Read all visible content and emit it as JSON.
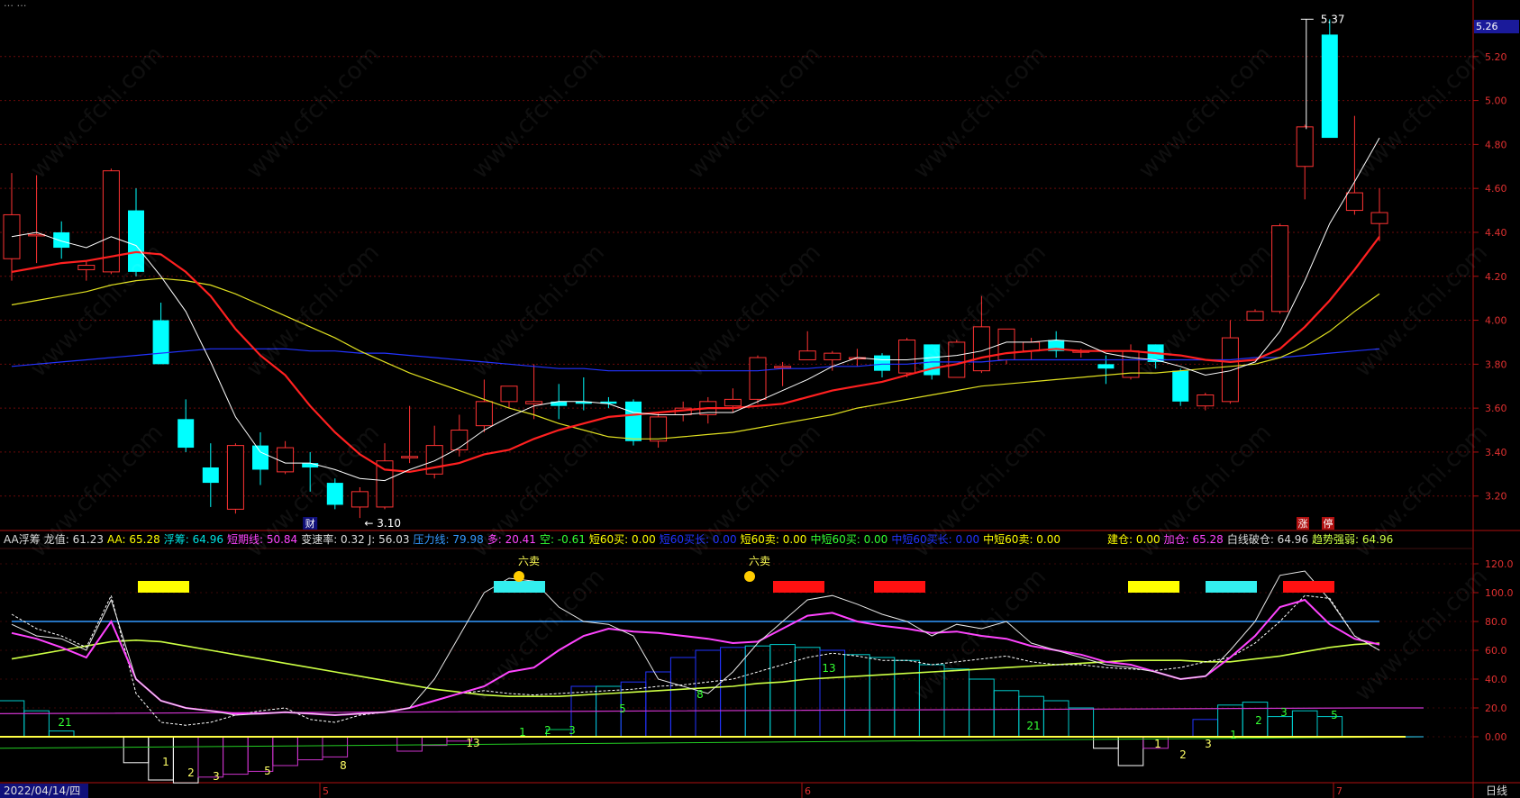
{
  "header": {
    "title_fragment": "… …"
  },
  "price_axis": {
    "ticks": [
      "5.26",
      "5.20",
      "5.00",
      "4.80",
      "4.60",
      "4.40",
      "4.20",
      "4.00",
      "3.80",
      "3.60",
      "3.40",
      "3.20"
    ],
    "current": "5.26"
  },
  "osc_axis": {
    "ticks": [
      "120.0",
      "100.0",
      "80.0",
      "60.0",
      "40.0",
      "20.0",
      "0.00"
    ]
  },
  "annotations": {
    "high": "5.37",
    "low": "← 3.10",
    "fin_marker": "财",
    "zhang": "涨",
    "ting": "停",
    "sell1": "六卖",
    "sell2": "六卖"
  },
  "indicator_bar": [
    {
      "text": "AA浮筹",
      "color": "#dddddd"
    },
    {
      "text": "龙值: 61.23",
      "color": "#dddddd"
    },
    {
      "text": "AA: 65.28",
      "color": "#ffff00"
    },
    {
      "text": "浮筹: 64.96",
      "color": "#00e0e0"
    },
    {
      "text": "短期线: 50.84",
      "color": "#ff44ff"
    },
    {
      "text": "变速率: 0.32",
      "color": "#dddddd"
    },
    {
      "text": "J: 56.03",
      "color": "#dddddd"
    },
    {
      "text": "压力线: 79.98",
      "color": "#3399ff"
    },
    {
      "text": "多: 20.41",
      "color": "#ff44ff"
    },
    {
      "text": "空: -0.61",
      "color": "#33ff33"
    },
    {
      "text": "短60买: 0.00",
      "color": "#ffff00"
    },
    {
      "text": "短60买长: 0.00",
      "color": "#2233ff"
    },
    {
      "text": "短60卖: 0.00",
      "color": "#ffff00"
    },
    {
      "text": "中短60买: 0.00",
      "color": "#33ff33"
    },
    {
      "text": "中短60买长: 0.00",
      "color": "#2233ff"
    },
    {
      "text": "中短60卖: 0.00",
      "color": "#ffff00"
    },
    {
      "text": "建仓: 0.00",
      "color": "#ffff00"
    },
    {
      "text": "加仓: 65.28",
      "color": "#ff44ff"
    },
    {
      "text": "白线破仓: 64.96",
      "color": "#dddddd"
    },
    {
      "text": "趋势强弱: 64.96",
      "color": "#ccff44"
    }
  ],
  "time_axis": {
    "date": "2022/04/14/四",
    "months": [
      "5",
      "6",
      "7"
    ],
    "period": "日线"
  },
  "watermark": "www.cfchi.com",
  "colors": {
    "up": "#ff3333",
    "down": "#00ffff",
    "ma5": "#ffffff",
    "ma10": "#ff2020",
    "ma20": "#e0e020",
    "ma60": "#2233ff"
  },
  "chart_data": [
    {
      "type": "candlestick",
      "ylim": [
        3.08,
        5.4
      ],
      "candles": [
        [
          4.28,
          4.48,
          4.67,
          4.18
        ],
        [
          4.39,
          4.39,
          4.66,
          4.26
        ],
        [
          4.4,
          4.33,
          4.45,
          4.28
        ],
        [
          4.23,
          4.25,
          4.27,
          4.18
        ],
        [
          4.22,
          4.68,
          4.69,
          4.21
        ],
        [
          4.5,
          4.22,
          4.6,
          4.2
        ],
        [
          4.0,
          3.8,
          4.08,
          3.8
        ],
        [
          3.55,
          3.42,
          3.64,
          3.4
        ],
        [
          3.33,
          3.26,
          3.44,
          3.15
        ],
        [
          3.14,
          3.43,
          3.44,
          3.12
        ],
        [
          3.43,
          3.32,
          3.49,
          3.25
        ],
        [
          3.31,
          3.42,
          3.45,
          3.3
        ],
        [
          3.35,
          3.33,
          3.4,
          3.22
        ],
        [
          3.26,
          3.16,
          3.28,
          3.14
        ],
        [
          3.15,
          3.22,
          3.24,
          3.1
        ],
        [
          3.15,
          3.36,
          3.44,
          3.14
        ],
        [
          3.38,
          3.38,
          3.61,
          3.35
        ],
        [
          3.3,
          3.43,
          3.52,
          3.28
        ],
        [
          3.41,
          3.5,
          3.57,
          3.38
        ],
        [
          3.52,
          3.63,
          3.73,
          3.49
        ],
        [
          3.63,
          3.7,
          3.7,
          3.6
        ],
        [
          3.62,
          3.63,
          3.8,
          3.55
        ],
        [
          3.63,
          3.61,
          3.71,
          3.55
        ],
        [
          3.63,
          3.62,
          3.74,
          3.59
        ],
        [
          3.63,
          3.62,
          3.65,
          3.6
        ],
        [
          3.63,
          3.45,
          3.64,
          3.43
        ],
        [
          3.45,
          3.56,
          3.58,
          3.42
        ],
        [
          3.57,
          3.6,
          3.63,
          3.54
        ],
        [
          3.57,
          3.63,
          3.65,
          3.53
        ],
        [
          3.61,
          3.64,
          3.69,
          3.58
        ],
        [
          3.64,
          3.83,
          3.84,
          3.62
        ],
        [
          3.79,
          3.79,
          3.81,
          3.7
        ],
        [
          3.82,
          3.86,
          3.95,
          3.82
        ],
        [
          3.82,
          3.85,
          3.86,
          3.77
        ],
        [
          3.83,
          3.83,
          3.87,
          3.79
        ],
        [
          3.84,
          3.77,
          3.85,
          3.74
        ],
        [
          3.76,
          3.91,
          3.92,
          3.74
        ],
        [
          3.89,
          3.75,
          3.89,
          3.73
        ],
        [
          3.74,
          3.9,
          3.91,
          3.74
        ],
        [
          3.77,
          3.97,
          4.11,
          3.76
        ],
        [
          3.82,
          3.96,
          3.96,
          3.8
        ],
        [
          3.86,
          3.9,
          3.92,
          3.82
        ],
        [
          3.91,
          3.86,
          3.95,
          3.83
        ],
        [
          3.86,
          3.86,
          3.87,
          3.83
        ],
        [
          3.8,
          3.78,
          3.84,
          3.71
        ],
        [
          3.74,
          3.86,
          3.89,
          3.73
        ],
        [
          3.89,
          3.81,
          3.89,
          3.78
        ],
        [
          3.77,
          3.63,
          3.78,
          3.61
        ],
        [
          3.61,
          3.66,
          3.67,
          3.59
        ],
        [
          3.63,
          3.92,
          4.0,
          3.62
        ],
        [
          4.0,
          4.04,
          4.05,
          4.0
        ],
        [
          4.04,
          4.43,
          4.44,
          4.03
        ],
        [
          4.7,
          4.88,
          4.89,
          4.55
        ],
        [
          5.3,
          4.83,
          5.37,
          4.83
        ],
        [
          4.5,
          4.58,
          4.93,
          4.48
        ],
        [
          4.44,
          4.49,
          4.6,
          4.36
        ]
      ],
      "ma5": [
        4.38,
        4.4,
        4.36,
        4.33,
        4.38,
        4.34,
        4.2,
        4.04,
        3.81,
        3.56,
        3.4,
        3.35,
        3.35,
        3.32,
        3.28,
        3.27,
        3.32,
        3.36,
        3.42,
        3.5,
        3.56,
        3.61,
        3.63,
        3.63,
        3.62,
        3.58,
        3.57,
        3.57,
        3.58,
        3.58,
        3.63,
        3.68,
        3.73,
        3.79,
        3.83,
        3.82,
        3.82,
        3.83,
        3.84,
        3.86,
        3.9,
        3.9,
        3.91,
        3.9,
        3.85,
        3.83,
        3.82,
        3.79,
        3.75,
        3.77,
        3.81,
        3.95,
        4.18,
        4.44,
        4.63,
        4.83
      ],
      "ma10": [
        4.22,
        4.24,
        4.26,
        4.27,
        4.29,
        4.31,
        4.3,
        4.22,
        4.11,
        3.96,
        3.84,
        3.75,
        3.61,
        3.49,
        3.39,
        3.32,
        3.31,
        3.33,
        3.35,
        3.39,
        3.41,
        3.46,
        3.5,
        3.53,
        3.56,
        3.57,
        3.58,
        3.59,
        3.6,
        3.6,
        3.61,
        3.62,
        3.65,
        3.68,
        3.7,
        3.72,
        3.75,
        3.78,
        3.8,
        3.83,
        3.85,
        3.86,
        3.87,
        3.86,
        3.86,
        3.86,
        3.85,
        3.84,
        3.82,
        3.81,
        3.82,
        3.87,
        3.97,
        4.09,
        4.23,
        4.38
      ],
      "ma20": [
        4.07,
        4.09,
        4.11,
        4.13,
        4.16,
        4.18,
        4.19,
        4.18,
        4.16,
        4.12,
        4.07,
        4.02,
        3.97,
        3.92,
        3.86,
        3.81,
        3.76,
        3.72,
        3.68,
        3.64,
        3.6,
        3.57,
        3.53,
        3.5,
        3.47,
        3.46,
        3.46,
        3.47,
        3.48,
        3.49,
        3.51,
        3.53,
        3.55,
        3.57,
        3.6,
        3.62,
        3.64,
        3.66,
        3.68,
        3.7,
        3.71,
        3.72,
        3.73,
        3.74,
        3.75,
        3.76,
        3.76,
        3.77,
        3.78,
        3.79,
        3.8,
        3.83,
        3.88,
        3.95,
        4.04,
        4.12
      ],
      "ma60": [
        3.79,
        3.8,
        3.81,
        3.82,
        3.83,
        3.84,
        3.85,
        3.86,
        3.87,
        3.87,
        3.87,
        3.87,
        3.86,
        3.86,
        3.85,
        3.85,
        3.84,
        3.83,
        3.82,
        3.81,
        3.8,
        3.79,
        3.78,
        3.78,
        3.77,
        3.77,
        3.77,
        3.77,
        3.77,
        3.77,
        3.77,
        3.78,
        3.78,
        3.79,
        3.79,
        3.8,
        3.8,
        3.81,
        3.81,
        3.81,
        3.82,
        3.82,
        3.82,
        3.82,
        3.82,
        3.82,
        3.82,
        3.82,
        3.82,
        3.82,
        3.83,
        3.83,
        3.84,
        3.85,
        3.86,
        3.87
      ]
    },
    {
      "type": "line",
      "ylim": [
        -30,
        130
      ],
      "pressure": [
        80,
        80,
        80,
        80,
        80,
        80,
        80,
        80,
        80,
        80,
        80,
        80,
        80,
        80,
        80,
        80,
        80,
        80,
        80,
        80,
        80,
        80,
        80,
        80,
        80,
        80,
        80,
        80,
        80,
        80,
        80,
        80,
        80,
        80,
        80,
        80,
        80,
        80,
        80,
        80,
        80,
        80,
        80,
        80,
        80,
        80,
        80,
        80,
        80,
        80,
        80,
        80,
        80,
        80,
        80,
        80
      ],
      "trend": [
        54,
        57,
        60,
        63,
        66,
        67,
        66,
        63,
        60,
        57,
        54,
        51,
        48,
        45,
        42,
        39,
        36,
        33,
        31,
        29,
        28,
        28,
        28,
        29,
        30,
        31,
        32,
        33,
        34,
        35,
        37,
        38,
        40,
        41,
        42,
        43,
        44,
        45,
        46,
        47,
        48,
        49,
        50,
        51,
        52,
        53,
        53,
        53,
        52,
        52,
        54,
        56,
        59,
        62,
        64,
        65
      ],
      "white": [
        78,
        70,
        68,
        60,
        95,
        40,
        25,
        20,
        18,
        15,
        16,
        17,
        16,
        15,
        16,
        17,
        20,
        40,
        70,
        100,
        110,
        108,
        90,
        80,
        78,
        70,
        40,
        35,
        30,
        45,
        65,
        80,
        95,
        98,
        92,
        85,
        80,
        70,
        78,
        75,
        80,
        65,
        60,
        55,
        50,
        48,
        45,
        40,
        42,
        60,
        80,
        112,
        115,
        95,
        70,
        60
      ],
      "pinkAA": [
        72,
        68,
        62,
        55,
        80,
        40,
        25,
        20,
        18,
        16,
        16,
        17,
        16,
        15,
        16,
        17,
        20,
        25,
        30,
        35,
        45,
        48,
        60,
        70,
        75,
        73,
        72,
        70,
        68,
        65,
        66,
        75,
        84,
        86,
        80,
        77,
        75,
        72,
        73,
        70,
        68,
        63,
        60,
        57,
        52,
        50,
        45,
        40,
        42,
        55,
        70,
        90,
        95,
        78,
        68,
        64
      ],
      "dots": [
        85,
        75,
        70,
        62,
        98,
        30,
        10,
        8,
        10,
        15,
        18,
        20,
        12,
        10,
        15,
        17,
        20,
        25,
        30,
        32,
        30,
        29,
        30,
        31,
        32,
        33,
        35,
        36,
        38,
        40,
        45,
        50,
        55,
        58,
        56,
        53,
        53,
        50,
        52,
        54,
        56,
        52,
        50,
        50,
        48,
        47,
        46,
        48,
        52,
        55,
        65,
        80,
        98,
        96,
        70,
        60
      ]
    }
  ]
}
